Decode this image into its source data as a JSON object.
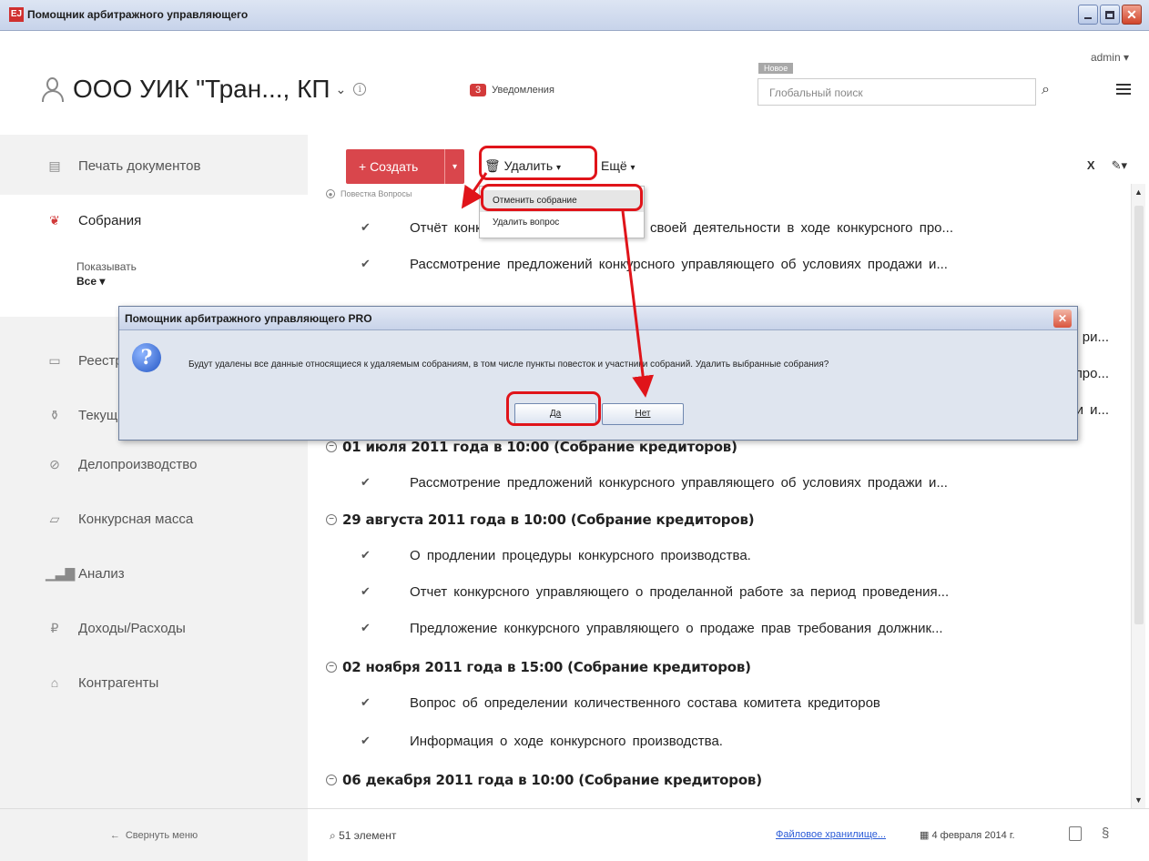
{
  "window": {
    "title": "Помощник арбитражного управляющего",
    "app_icon": "ЕЈ"
  },
  "header": {
    "user": "admin",
    "org_name": "ООО УИК \"Тран..., КП",
    "notifications_count": "3",
    "notifications_label": "Уведомления",
    "search_new_tag": "Новое",
    "search_placeholder": "Глобальный поиск"
  },
  "sidebar": {
    "items": [
      {
        "label": "Печать документов",
        "icon": "document-icon"
      },
      {
        "label": "Собрания",
        "icon": "handshake-icon"
      },
      {
        "label": "Реестр",
        "icon": "register-icon"
      },
      {
        "label": "Текущие",
        "icon": "flask-icon"
      },
      {
        "label": "Делопроизводство",
        "icon": "paperclip-icon"
      },
      {
        "label": "Конкурсная масса",
        "icon": "box-icon"
      },
      {
        "label": "Анализ",
        "icon": "bar-chart-icon"
      },
      {
        "label": "Доходы/Расходы",
        "icon": "money-icon"
      },
      {
        "label": "Контрагенты",
        "icon": "bank-icon"
      }
    ],
    "filter_label": "Показывать",
    "filter_value": "Все",
    "collapse_label": "Свернуть меню"
  },
  "toolbar": {
    "create_label": "+ Создать",
    "delete_label": "Удалить",
    "more_label": "Ещё",
    "excel_label": "X"
  },
  "dropdown": {
    "options": [
      "Отменить собрание",
      "Удалить вопрос"
    ]
  },
  "content": {
    "breadcrumb": "Повестка Вопросы",
    "rows": [
      {
        "kind": "item",
        "text": "Отчёт конкурсного управляющего о своей деятельности в ходе конкурсного про..."
      },
      {
        "kind": "item",
        "text": "Рассмотрение предложений конкурсного управляющего об условиях продажи и..."
      },
      {
        "kind": "item",
        "text": "ри..."
      },
      {
        "kind": "item",
        "text": "про..."
      },
      {
        "kind": "item",
        "text": "и и..."
      },
      {
        "kind": "group",
        "text": "01 июля 2011 года в 10:00 (Собрание кредиторов)"
      },
      {
        "kind": "item",
        "text": "Рассмотрение предложений конкурсного управляющего об условиях продажи и..."
      },
      {
        "kind": "group",
        "text": "29 августа 2011 года в 10:00 (Собрание кредиторов)"
      },
      {
        "kind": "item",
        "text": "О продлении процедуры конкурсного производства."
      },
      {
        "kind": "item",
        "text": "Отчет конкурсного управляющего о проделанной работе за период проведения..."
      },
      {
        "kind": "item",
        "text": "Предложение конкурсного управляющего о продаже прав требования должник..."
      },
      {
        "kind": "group",
        "text": "02 ноября 2011 года в 15:00 (Собрание кредиторов)"
      },
      {
        "kind": "item",
        "text": "Вопрос об определении количественного состава комитета кредиторов"
      },
      {
        "kind": "item",
        "text": "Информация о ходе конкурсного производства."
      },
      {
        "kind": "group",
        "text": "06 декабря 2011 года в 10:00 (Собрание кредиторов)"
      }
    ]
  },
  "dialog": {
    "title": "Помощник арбитражного управляющего PRO",
    "message": "Будут удалены все данные относящиеся к удаляемым собраниям, в том числе пункты повесток и участники собраний. Удалить выбранные собрания?",
    "yes_label": "Да",
    "no_label": "Нет"
  },
  "footer": {
    "count": "51 элемент",
    "storage_link": "Файловое хранилище...",
    "date": "4 февраля 2014 г.",
    "para_symbol": "§"
  },
  "colors": {
    "accent": "#d9464c",
    "highlight": "#e0141a",
    "link": "#2a5bd7"
  }
}
